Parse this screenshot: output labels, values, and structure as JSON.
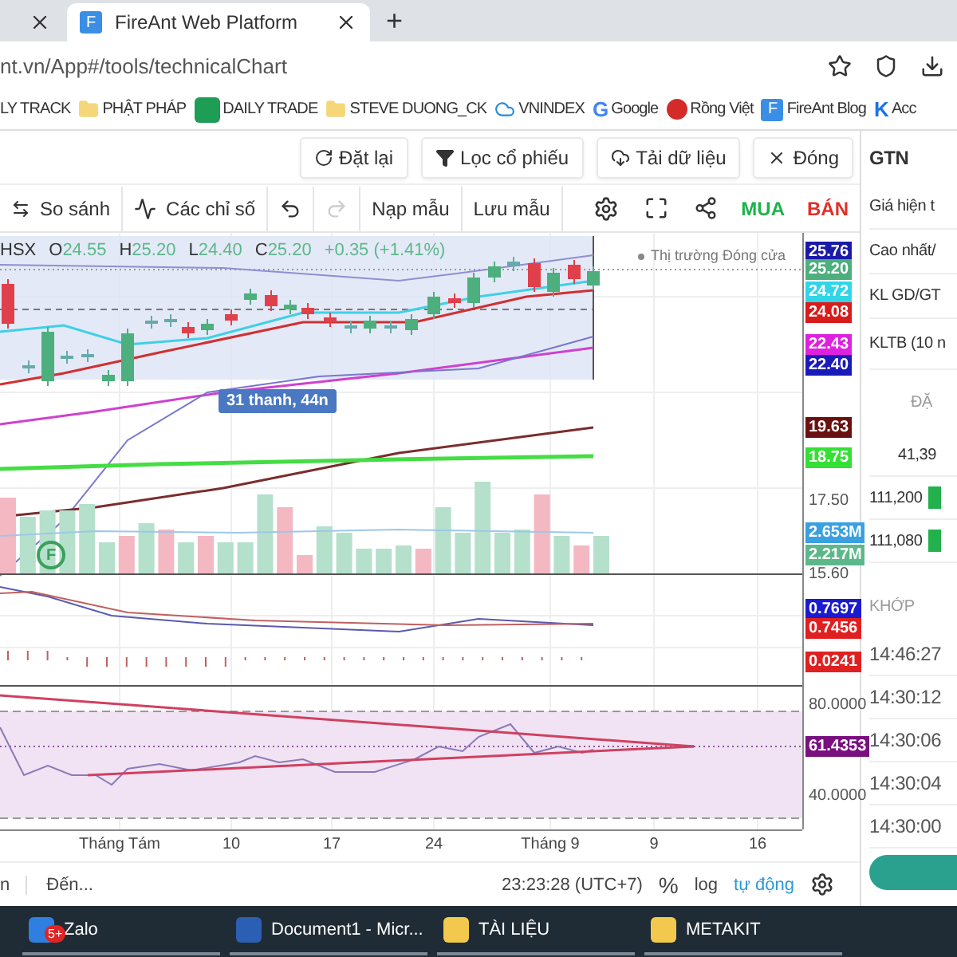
{
  "browser": {
    "tabs": [
      {
        "selected": false
      },
      {
        "title": "FireAnt Web Platform",
        "favicon": "F",
        "selected": true
      }
    ],
    "new_tab": "+",
    "url": "nt.vn/App#/tools/technicalChart"
  },
  "bookmarks": [
    {
      "kind": "none",
      "label": "LY TRACK"
    },
    {
      "kind": "folder",
      "label": "PHẬT PHÁP"
    },
    {
      "kind": "sheet",
      "label": "DAILY TRADE"
    },
    {
      "kind": "folder",
      "label": "STEVE DUONG_CK"
    },
    {
      "kind": "cloud",
      "label": "VNINDEX"
    },
    {
      "kind": "letter",
      "icon_text": "G",
      "color": "#4285f4",
      "label": "Google"
    },
    {
      "kind": "dragon",
      "label": "Rồng Việt"
    },
    {
      "kind": "tile",
      "icon_text": "F",
      "color": "#3a8ee6",
      "label": "FireAnt Blog"
    },
    {
      "kind": "letter",
      "icon_text": "K",
      "color": "#1a73e8",
      "label": "Acc"
    }
  ],
  "app_toolbar": [
    {
      "kind": "reset",
      "label": "Đặt lại"
    },
    {
      "kind": "filter",
      "label": "Lọc cổ phiếu"
    },
    {
      "kind": "download",
      "label": "Tải dữ liệu"
    },
    {
      "kind": "close",
      "label": "Đóng"
    }
  ],
  "chart_toolbar": {
    "compare": "So sánh",
    "indicators": "Các chỉ số",
    "load_template": "Nạp mẫu",
    "save_template": "Lưu mẫu",
    "buy": "MUA",
    "sell": "BÁN"
  },
  "legend": {
    "exchange": "HSX",
    "fields": [
      {
        "label": "O",
        "value": "24.55"
      },
      {
        "label": "H",
        "value": "25.20"
      },
      {
        "label": "L",
        "value": "24.40"
      },
      {
        "label": "C",
        "value": "25.20"
      }
    ],
    "change": "+0.35 (+1.41%)"
  },
  "market_status": "Thị trường Đóng cửa",
  "bar_tooltip": "31 thanh, 44n",
  "event_marker": "F",
  "price_tags": [
    {
      "kind": "tag",
      "text": "25.76",
      "color": "#1a1aa8"
    },
    {
      "kind": "tag",
      "text": "25.20",
      "color": "#4caf7d"
    },
    {
      "kind": "tag",
      "text": "24.72",
      "color": "#30d5e8"
    },
    {
      "kind": "tag",
      "text": "24.08",
      "color": "#d81b1b"
    },
    {
      "kind": "tag",
      "text": "22.43",
      "color": "#e020e0"
    },
    {
      "kind": "tag",
      "text": "22.40",
      "color": "#1a1ab8"
    },
    {
      "kind": "tag",
      "text": "19.63",
      "color": "#6b1010"
    },
    {
      "kind": "tag",
      "text": "18.75",
      "color": "#33e033"
    },
    {
      "kind": "tick",
      "text": "17.50"
    },
    {
      "kind": "tag",
      "text": "2.653M",
      "color": "#3aa0e0"
    },
    {
      "kind": "tag",
      "text": "2.217M",
      "color": "#5cb88a"
    },
    {
      "kind": "tick",
      "text": "15.60"
    },
    {
      "kind": "tag",
      "text": "0.7697",
      "color": "#1a1ad0"
    },
    {
      "kind": "tag",
      "text": "0.7456",
      "color": "#e02020"
    },
    {
      "kind": "tag",
      "text": "0.0241",
      "color": "#e02020"
    },
    {
      "kind": "tick",
      "text": "80.0000"
    },
    {
      "kind": "tag",
      "text": "61.4353",
      "color": "#7a1080"
    },
    {
      "kind": "tick",
      "text": "40.0000"
    }
  ],
  "time_axis": [
    "Tháng Tám",
    "10",
    "17",
    "24",
    "Tháng 9",
    "9",
    "16"
  ],
  "bottom_bar": {
    "range_start": "n",
    "range_end": "Đến...",
    "clock": "23:23:28 (UTC+7)",
    "percent": "%",
    "log": "log",
    "auto": "tự động"
  },
  "side_panel": {
    "symbol": "GTN",
    "labels": [
      "Giá hiện t",
      "Cao nhất/",
      "KL GD/GT",
      "KLTB (10 n"
    ],
    "order_header": "ĐẶ",
    "order_total": "41,39",
    "orders": [
      "111,200",
      "111,080"
    ],
    "trades_header": "KHỚP",
    "trade_times": [
      "14:46:27",
      "14:30:12",
      "14:30:06",
      "14:30:04",
      "14:30:00"
    ]
  },
  "taskbar": [
    {
      "kind": "zalo",
      "label": "Zalo",
      "badge": "5+"
    },
    {
      "kind": "word",
      "label": "Document1 - Micr..."
    },
    {
      "kind": "folder",
      "label": "TÀI LIỆU"
    },
    {
      "kind": "folder",
      "label": "METAKIT"
    }
  ]
}
